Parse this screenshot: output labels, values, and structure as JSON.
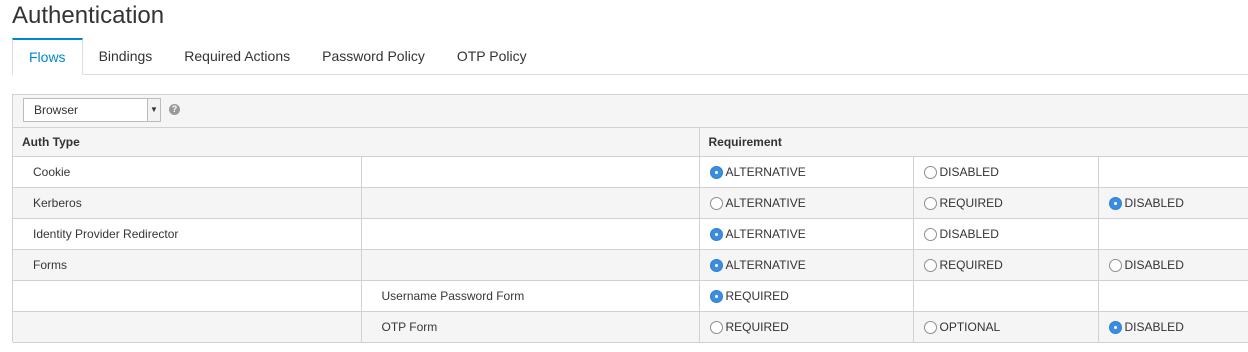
{
  "page": {
    "title": "Authentication"
  },
  "tabs": [
    {
      "label": "Flows",
      "active": true
    },
    {
      "label": "Bindings",
      "active": false
    },
    {
      "label": "Required Actions",
      "active": false
    },
    {
      "label": "Password Policy",
      "active": false
    },
    {
      "label": "OTP Policy",
      "active": false
    }
  ],
  "flow_select": {
    "value": "Browser"
  },
  "table": {
    "headers": {
      "auth_type": "Auth Type",
      "requirement": "Requirement"
    },
    "rows": [
      {
        "name": "Cookie",
        "sub": "",
        "options": [
          {
            "label": "ALTERNATIVE",
            "checked": true
          },
          {
            "label": "DISABLED",
            "checked": false
          },
          null
        ]
      },
      {
        "name": "Kerberos",
        "sub": "",
        "options": [
          {
            "label": "ALTERNATIVE",
            "checked": false
          },
          {
            "label": "REQUIRED",
            "checked": false
          },
          {
            "label": "DISABLED",
            "checked": true
          }
        ]
      },
      {
        "name": "Identity Provider Redirector",
        "sub": "",
        "options": [
          {
            "label": "ALTERNATIVE",
            "checked": true
          },
          {
            "label": "DISABLED",
            "checked": false
          },
          null
        ]
      },
      {
        "name": "Forms",
        "sub": "",
        "options": [
          {
            "label": "ALTERNATIVE",
            "checked": true
          },
          {
            "label": "REQUIRED",
            "checked": false
          },
          {
            "label": "DISABLED",
            "checked": false
          }
        ]
      },
      {
        "name": "",
        "sub": "Username Password Form",
        "options": [
          {
            "label": "REQUIRED",
            "checked": true
          },
          null,
          null
        ]
      },
      {
        "name": "",
        "sub": "OTP Form",
        "options": [
          {
            "label": "REQUIRED",
            "checked": false
          },
          {
            "label": "OPTIONAL",
            "checked": false
          },
          {
            "label": "DISABLED",
            "checked": true
          }
        ]
      }
    ]
  },
  "colors": {
    "accent": "#0088ce",
    "radio_checked": "#3a8de0"
  }
}
